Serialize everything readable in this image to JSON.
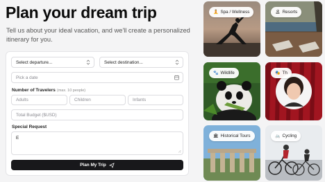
{
  "hero": {
    "title": "Plan your dream trip",
    "subtitle": "Tell us about your ideal vacation, and we'll create a personalized itinerary for you."
  },
  "form": {
    "departure_placeholder": "Select departure...",
    "destination_placeholder": "Select destination...",
    "date_placeholder": "Pick a date",
    "travelers_label": "Number of Travelers",
    "travelers_hint": "(max. 10 people)",
    "adults_placeholder": "Adults",
    "children_placeholder": "Children",
    "infants_placeholder": "Infants",
    "budget_placeholder": "Total Budget ($USD)",
    "special_label": "Special Request",
    "special_value": "E",
    "submit_label": "Plan My Trip"
  },
  "tiles": [
    {
      "label": "Spa / Wellness",
      "icon": "lotus-icon"
    },
    {
      "label": "Resorts",
      "icon": "resort-icon"
    },
    {
      "label": "Wildlife",
      "icon": "paw-icon"
    },
    {
      "label": "Th",
      "icon": "theater-icon"
    },
    {
      "label": "Historical Tours",
      "icon": "monument-icon"
    },
    {
      "label": "Cycling",
      "icon": "bike-icon"
    }
  ],
  "colors": {
    "button": "#18181b",
    "background": "#f4f4f5"
  }
}
